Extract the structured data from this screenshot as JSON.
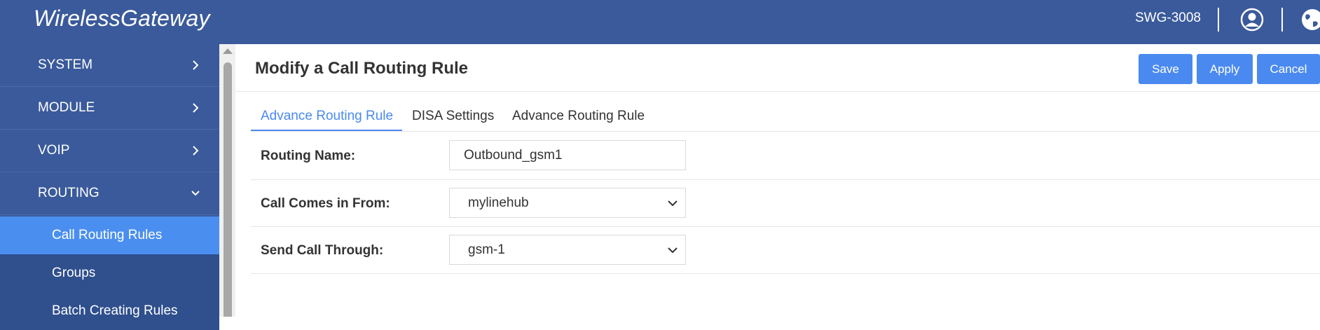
{
  "header": {
    "brand": "WirelessGateway",
    "model": "SWG-3008",
    "icons": [
      "user-icon",
      "globe-icon"
    ]
  },
  "sidebar": {
    "items": [
      {
        "label": "SYSTEM",
        "chevron": "chevron-right-icon"
      },
      {
        "label": "MODULE",
        "chevron": "chevron-right-icon"
      },
      {
        "label": "VOIP",
        "chevron": "chevron-right-icon"
      },
      {
        "label": "ROUTING",
        "chevron": "chevron-down-icon"
      }
    ],
    "subitems": [
      {
        "label": "Call Routing Rules",
        "active": true
      },
      {
        "label": "Groups",
        "active": false
      },
      {
        "label": "Batch Creating Rules",
        "active": false
      }
    ]
  },
  "main": {
    "title": "Modify a Call Routing Rule",
    "buttons": {
      "save": "Save",
      "apply": "Apply",
      "cancel": "Cancel"
    },
    "tabs": [
      {
        "label": "Advance Routing Rule",
        "active": true
      },
      {
        "label": "DISA Settings",
        "active": false
      },
      {
        "label": "Advance Routing Rule",
        "active": false
      }
    ],
    "fields": {
      "routing_name": {
        "label": "Routing Name:",
        "value": "Outbound_gsm1"
      },
      "call_comes_from": {
        "label": "Call Comes in From:",
        "value": "mylinehub"
      },
      "send_call_through": {
        "label": "Send Call Through:",
        "value": "gsm-1"
      }
    }
  },
  "colors": {
    "header_bg": "#3a5a9b",
    "sidebar_active": "#4a8ff0",
    "accent": "#4a8af0"
  }
}
